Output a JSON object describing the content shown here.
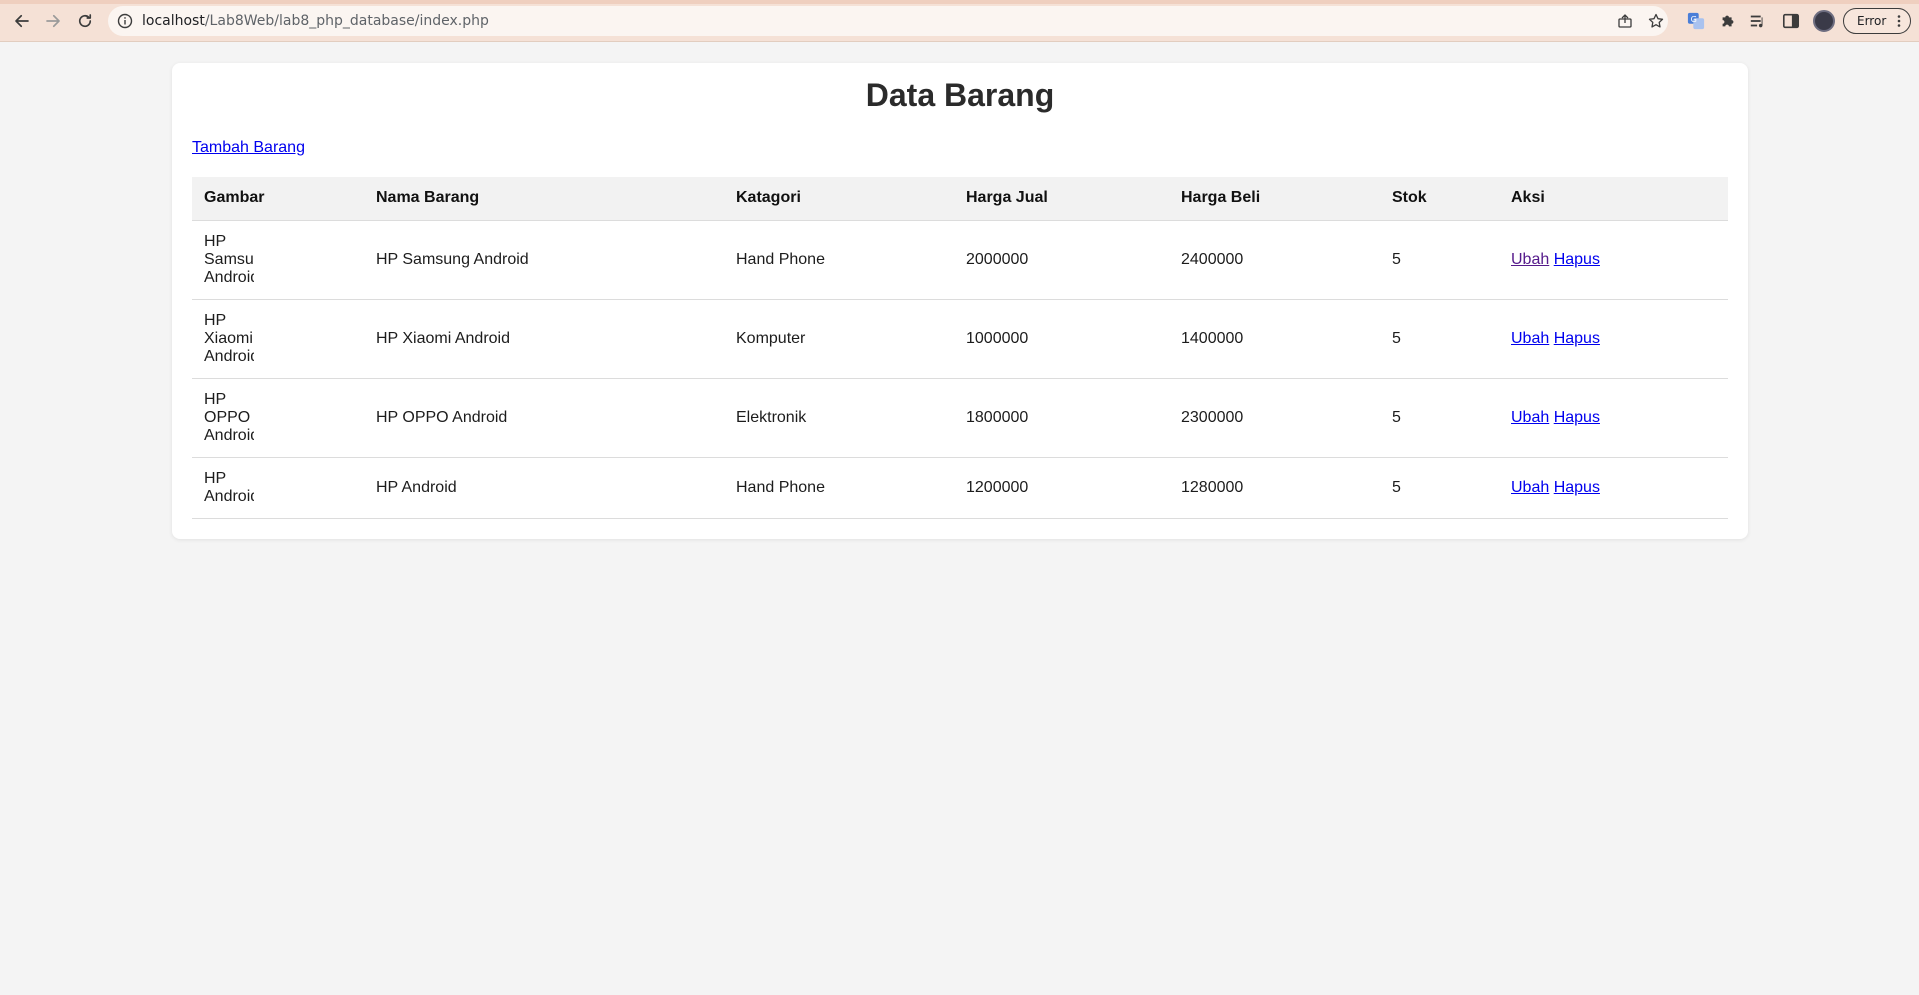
{
  "browser": {
    "url_host": "localhost",
    "url_path": "/Lab8Web/lab8_php_database/index.php",
    "profile_status": "Error"
  },
  "page": {
    "title": "Data Barang",
    "add_link": "Tambah Barang"
  },
  "table": {
    "headers": [
      "Gambar",
      "Nama Barang",
      "Katagori",
      "Harga Jual",
      "Harga Beli",
      "Stok",
      "Aksi"
    ],
    "rows": [
      {
        "image_alt": "HP Samsung Android",
        "nama": "HP Samsung Android",
        "kategori": "Hand Phone",
        "harga_jual": "2000000",
        "harga_beli": "2400000",
        "stok": "5",
        "edit": "Ubah",
        "delete": "Hapus"
      },
      {
        "image_alt": "HP Xiaomi Android",
        "nama": "HP Xiaomi Android",
        "kategori": "Komputer",
        "harga_jual": "1000000",
        "harga_beli": "1400000",
        "stok": "5",
        "edit": "Ubah",
        "delete": "Hapus"
      },
      {
        "image_alt": "HP OPPO Android",
        "nama": "HP OPPO Android",
        "kategori": "Elektronik",
        "harga_jual": "1800000",
        "harga_beli": "2300000",
        "stok": "5",
        "edit": "Ubah",
        "delete": "Hapus"
      },
      {
        "image_alt": "HP Android",
        "nama": "HP Android",
        "kategori": "Hand Phone",
        "harga_jual": "1200000",
        "harga_beli": "1280000",
        "stok": "5",
        "edit": "Ubah",
        "delete": "Hapus"
      }
    ]
  },
  "icons": {
    "back": "arrow-left-icon",
    "forward": "arrow-right-icon",
    "reload": "reload-icon",
    "site_info": "info-icon",
    "share": "share-icon",
    "bookmark": "star-icon",
    "translate": "translate-icon",
    "extensions": "puzzle-icon",
    "media": "media-queue-icon",
    "side_panel": "side-panel-icon",
    "menu": "kebab-menu-icon"
  },
  "colors": {
    "chrome_bg": "#f5e1d6",
    "page_bg": "#f4f4f4",
    "link": "#0000ee",
    "visited_link": "#551a8b"
  }
}
